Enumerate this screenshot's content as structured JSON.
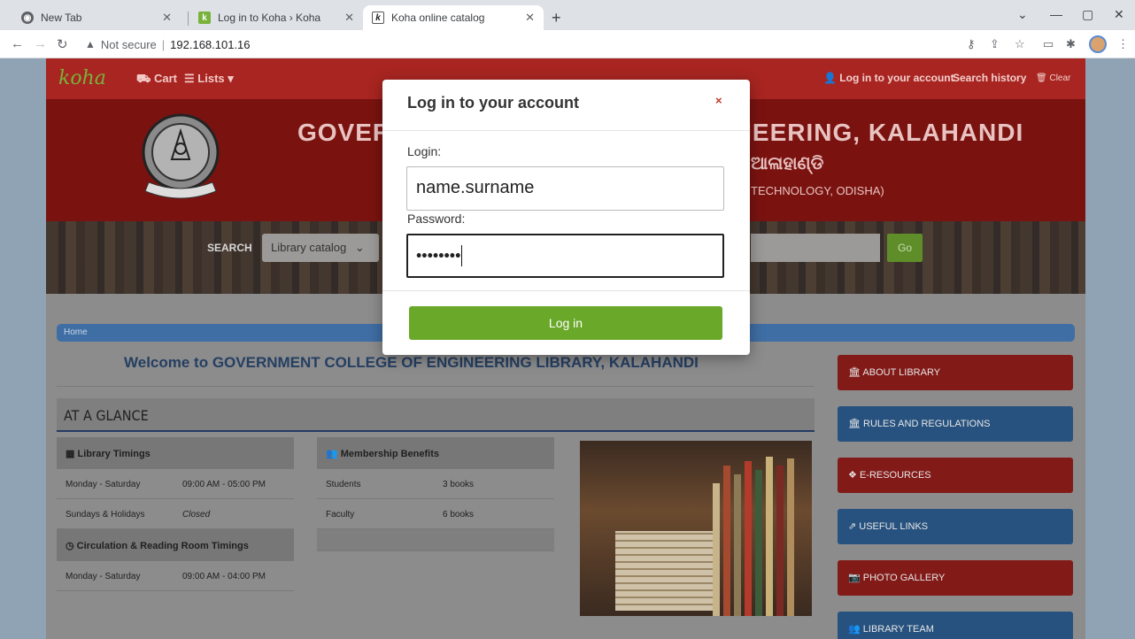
{
  "browser": {
    "tabs": [
      {
        "title": "New Tab"
      },
      {
        "title": "Log in to Koha › Koha"
      },
      {
        "title": "Koha online catalog"
      }
    ],
    "address": {
      "security": "Not secure",
      "url": "192.168.101.16"
    }
  },
  "koha_nav": {
    "logo": "koha",
    "cart": "Cart",
    "lists": "Lists",
    "login_link": "Log in to your account",
    "search_history": "Search history",
    "clear": "Clear"
  },
  "banner": {
    "title": "GOVERNMENT COLLEGE OF ENGINEERING, KALAHANDI",
    "sub_odia": "ଆଳାହାଣ୍ଡି",
    "sub_en": "TECHNOLOGY, ODISHA)"
  },
  "search": {
    "label": "SEARCH",
    "scope": "Library catalog",
    "go": "Go"
  },
  "breadcrumb": "Home",
  "welcome": "Welcome to GOVERNMENT COLLEGE OF ENGINEERING LIBRARY, KALAHANDI",
  "glance": "AT A GLANCE",
  "timings": {
    "title": "Library Timings",
    "rows": [
      {
        "day": "Monday - Saturday",
        "time": "09:00 AM - 05:00 PM"
      },
      {
        "day": "Sundays & Holidays",
        "time": "Closed"
      }
    ],
    "circ_title": "Circulation & Reading Room Timings",
    "circ_rows": [
      {
        "day": "Monday - Saturday",
        "time": "09:00 AM - 04:00 PM"
      }
    ]
  },
  "membership": {
    "title": "Membership Benefits",
    "rows": [
      {
        "who": "Students",
        "books": "3 books"
      },
      {
        "who": "Faculty",
        "books": "6 books"
      }
    ]
  },
  "side_buttons": [
    {
      "label": "ABOUT LIBRARY"
    },
    {
      "label": "RULES AND REGULATIONS"
    },
    {
      "label": "E-RESOURCES"
    },
    {
      "label": "USEFUL LINKS"
    },
    {
      "label": "PHOTO GALLERY"
    },
    {
      "label": "LIBRARY TEAM"
    }
  ],
  "modal": {
    "title": "Log in to your account",
    "close": "×",
    "login_label": "Login:",
    "login_value": "name.surname",
    "password_label": "Password:",
    "password_mask": "••••••••",
    "submit": "Log in"
  },
  "colors": {
    "koha_red": "#a82521",
    "login_green": "#6aa829",
    "side_red": "#c0302c",
    "side_blue": "#3a74b5"
  }
}
